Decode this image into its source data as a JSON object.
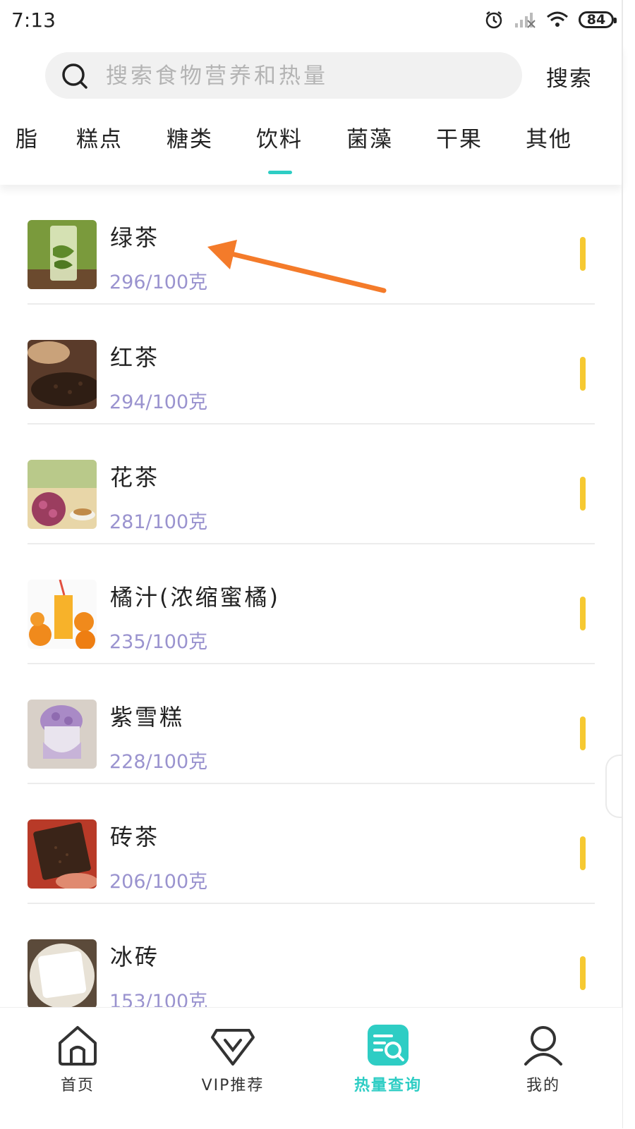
{
  "status_bar": {
    "time": "7:13",
    "battery": "84",
    "icons": [
      "alarm-icon",
      "signal-icon",
      "wifi-icon",
      "battery-icon"
    ]
  },
  "search": {
    "placeholder": "搜索食物营养和热量",
    "button_label": "搜索"
  },
  "tabs": {
    "items": [
      {
        "label": "脂"
      },
      {
        "label": "糕点"
      },
      {
        "label": "糖类"
      },
      {
        "label": "饮料"
      },
      {
        "label": "菌藻"
      },
      {
        "label": "干果"
      },
      {
        "label": "其他"
      }
    ],
    "active": "饮料",
    "accent_color": "#2ecdc4"
  },
  "foods": [
    {
      "name": "绿茶",
      "calories": "296/100克"
    },
    {
      "name": "红茶",
      "calories": "294/100克"
    },
    {
      "name": "花茶",
      "calories": "281/100克"
    },
    {
      "name": "橘汁(浓缩蜜橘)",
      "calories": "235/100克"
    },
    {
      "name": "紫雪糕",
      "calories": "228/100克"
    },
    {
      "name": "砖茶",
      "calories": "206/100克"
    },
    {
      "name": "冰砖",
      "calories": "153/100克"
    }
  ],
  "colors": {
    "calorie_text": "#9a93cf",
    "indicator_bar": "#f6c932",
    "annotation_arrow": "#f47b2a"
  },
  "bottom_nav": {
    "items": [
      {
        "label": "首页",
        "icon": "home-icon"
      },
      {
        "label": "VIP推荐",
        "icon": "vip-icon"
      },
      {
        "label": "热量查询",
        "icon": "calorie-search-icon"
      },
      {
        "label": "我的",
        "icon": "profile-icon"
      }
    ],
    "active": "热量查询"
  }
}
